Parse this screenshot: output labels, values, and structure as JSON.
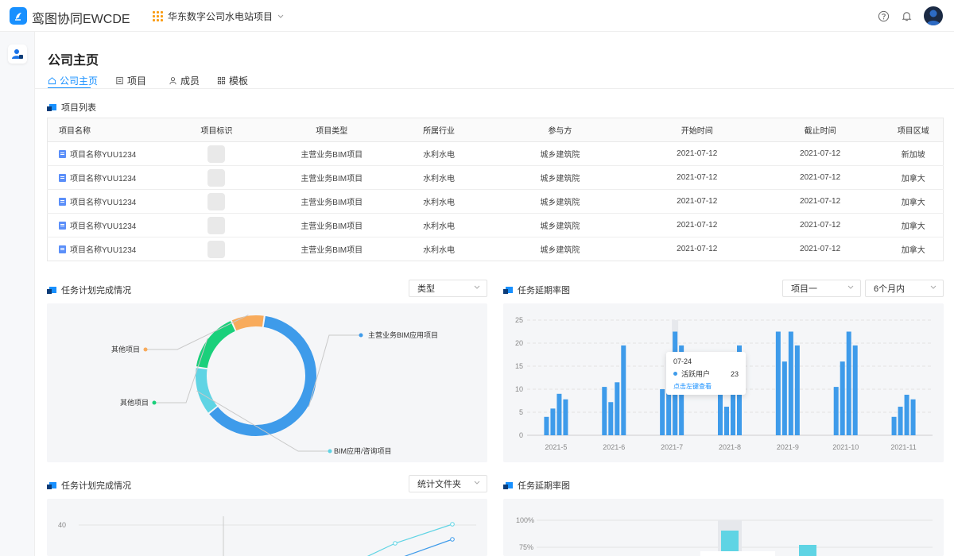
{
  "app": {
    "title": "鸾图协同EWCDE",
    "project_selector": "华东数字公司水电站项目"
  },
  "page": {
    "title": "公司主页"
  },
  "tabs": [
    {
      "label": "公司主页",
      "icon": "home-icon"
    },
    {
      "label": "项目",
      "icon": "document-icon"
    },
    {
      "label": "成员",
      "icon": "user-icon"
    },
    {
      "label": "模板",
      "icon": "grid-icon"
    }
  ],
  "project_list": {
    "title": "项目列表",
    "columns": [
      "项目名称",
      "项目标识",
      "项目类型",
      "所属行业",
      "参与方",
      "开始时间",
      "截止时间",
      "项目区域"
    ],
    "rows": [
      {
        "name": "项目名称YUU1234",
        "type": "主营业务BIM项目",
        "industry": "水利水电",
        "party": "城乡建筑院",
        "start": "2021-07-12",
        "end": "2021-07-12",
        "region": "新加坡"
      },
      {
        "name": "项目名称YUU1234",
        "type": "主营业务BIM项目",
        "industry": "水利水电",
        "party": "城乡建筑院",
        "start": "2021-07-12",
        "end": "2021-07-12",
        "region": "加拿大"
      },
      {
        "name": "项目名称YUU1234",
        "type": "主营业务BIM项目",
        "industry": "水利水电",
        "party": "城乡建筑院",
        "start": "2021-07-12",
        "end": "2021-07-12",
        "region": "加拿大"
      },
      {
        "name": "项目名称YUU1234",
        "type": "主营业务BIM项目",
        "industry": "水利水电",
        "party": "城乡建筑院",
        "start": "2021-07-12",
        "end": "2021-07-12",
        "region": "加拿大"
      },
      {
        "name": "项目名称YUU1234",
        "type": "主营业务BIM项目",
        "industry": "水利水电",
        "party": "城乡建筑院",
        "start": "2021-07-12",
        "end": "2021-07-12",
        "region": "加拿大"
      }
    ]
  },
  "task_plan": {
    "title": "任务计划完成情况",
    "select": "类型",
    "donut": [
      {
        "label": "主营业务BIM应用项目",
        "value": 62,
        "color": "#3e9bea"
      },
      {
        "label": "BIM应用/咨询项目",
        "value": 13,
        "color": "#5fd4e4"
      },
      {
        "label": "其他项目",
        "value": 16,
        "color": "#1ad07b"
      },
      {
        "label": "其他项目",
        "value": 9,
        "color": "#f8ab5c"
      }
    ]
  },
  "delay_rate": {
    "title": "任务延期率图",
    "select1": "项目一",
    "select2": "6个月内",
    "chart_data": {
      "type": "bar",
      "categories": [
        "2021-5",
        "2021-6",
        "2021-7",
        "2021-8",
        "2021-9",
        "2021-10",
        "2021-11"
      ],
      "series": [
        {
          "values": [
            4,
            10.5,
            10,
            10,
            22.5,
            10.5,
            4
          ]
        },
        {
          "values": [
            5.8,
            7.2,
            15.5,
            6.2,
            16,
            16,
            6.2
          ]
        },
        {
          "values": [
            9,
            11.5,
            22.5,
            10,
            22.5,
            22.5,
            8.8
          ]
        },
        {
          "values": [
            7.8,
            19.5,
            19.5,
            19.5,
            19.5,
            19.5,
            7.8
          ]
        }
      ],
      "ylim": [
        0,
        25
      ],
      "yticks": [
        0,
        5,
        10,
        15,
        20,
        25
      ],
      "color": "#3e9bea"
    },
    "tooltip": {
      "date": "07-24",
      "series": "活跃用户",
      "value": "23",
      "link": "点击左键查看"
    }
  },
  "task_plan2": {
    "title": "任务计划完成情况",
    "select": "统计文件夹",
    "y_top_tick": "40"
  },
  "delay_rate2": {
    "title": "任务延期率图",
    "yticks": [
      "100%",
      "75%"
    ]
  }
}
